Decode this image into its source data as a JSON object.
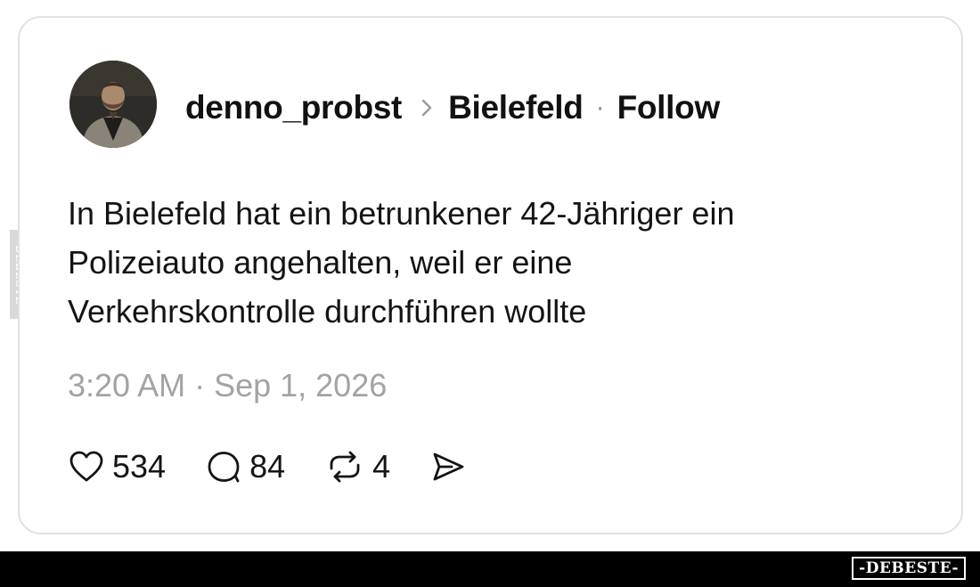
{
  "post": {
    "username": "denno_probst",
    "location": "Bielefeld",
    "follow_label": "Follow",
    "text_lines": [
      "In Bielefeld hat ein betrunkener 42-Jähriger ein",
      "Polizeiauto angehalten, weil er eine",
      "Verkehrskontrolle durchführen wollte"
    ],
    "timestamp": "3:20 AM · Sep 1, 2026",
    "avatar_icon": "profile-photo",
    "actions": {
      "likes": {
        "icon": "heart-icon",
        "count": "534"
      },
      "comments": {
        "icon": "comment-icon",
        "count": "84"
      },
      "reposts": {
        "icon": "repost-icon",
        "count": "4"
      },
      "share": {
        "icon": "send-icon"
      }
    }
  },
  "watermark": {
    "side_text": "DEBESTE",
    "brand_text": "-DEBESTE-"
  },
  "colors": {
    "card_border": "#e1e1e1",
    "text": "#111111",
    "muted": "#a3a3a3",
    "footer": "#000000"
  }
}
